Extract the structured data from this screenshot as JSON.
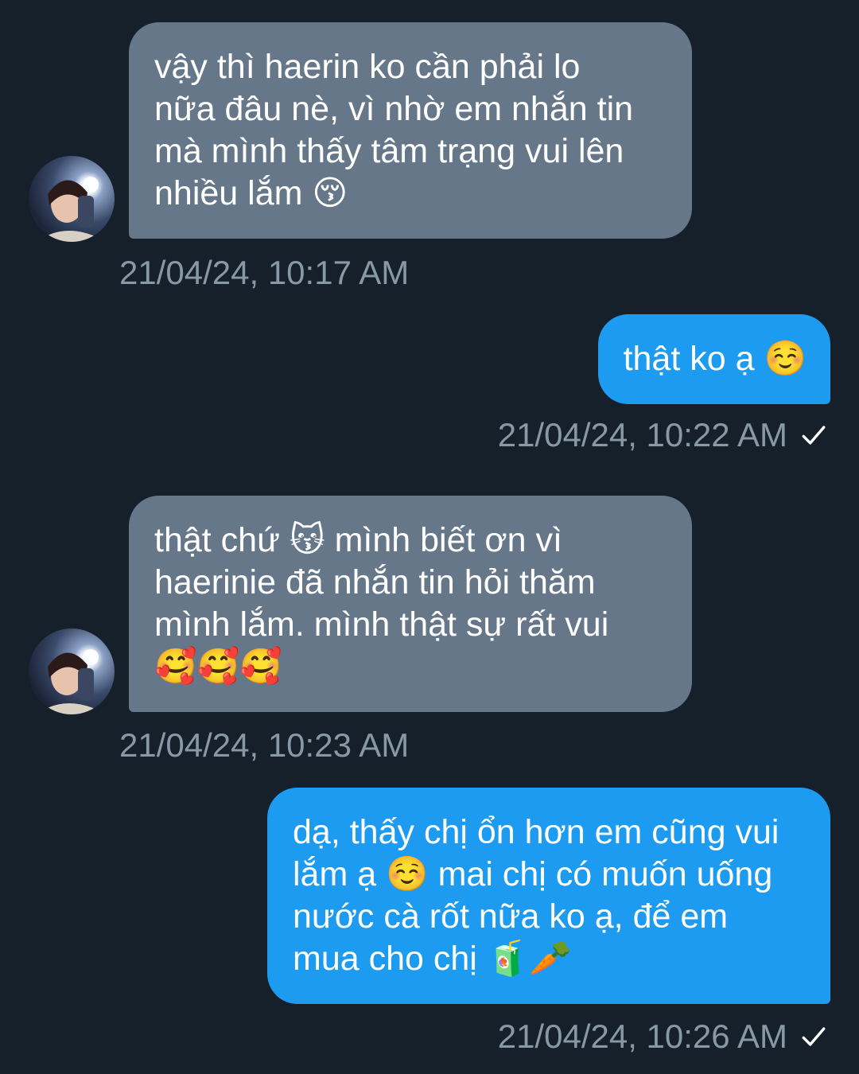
{
  "messages": [
    {
      "direction": "incoming",
      "lines": [
        "vậy thì haerin ko cần phải lo",
        "nữa đâu nè, vì nhờ em nhắn tin",
        "mà mình thấy tâm trạng vui lên",
        "nhiều lắm 😚"
      ],
      "timestamp": "21/04/24, 10:17 AM"
    },
    {
      "direction": "outgoing",
      "lines": [
        "thật ko ạ ☺️"
      ],
      "timestamp": "21/04/24, 10:22 AM",
      "status_icon": "check-icon"
    },
    {
      "direction": "incoming",
      "lines": [
        "thật chứ 😽 mình biết ơn vì",
        "haerinie đã nhắn tin hỏi thăm",
        "mình lắm. mình thật sự rất vui",
        "🥰🥰🥰"
      ],
      "timestamp": "21/04/24, 10:23 AM"
    },
    {
      "direction": "outgoing",
      "lines": [
        "dạ, thấy chị ổn hơn em cũng vui",
        "lắm ạ ☺️ mai chị có muốn uống",
        "nước cà rốt nữa ko ạ, để em",
        "mua cho chị 🧃🥕"
      ],
      "timestamp": "21/04/24, 10:26 AM",
      "status_icon": "check-icon"
    }
  ],
  "colors": {
    "background": "#15202b",
    "incoming_bubble": "#66778a",
    "outgoing_bubble": "#1d9bf0",
    "timestamp": "#8899a6"
  }
}
